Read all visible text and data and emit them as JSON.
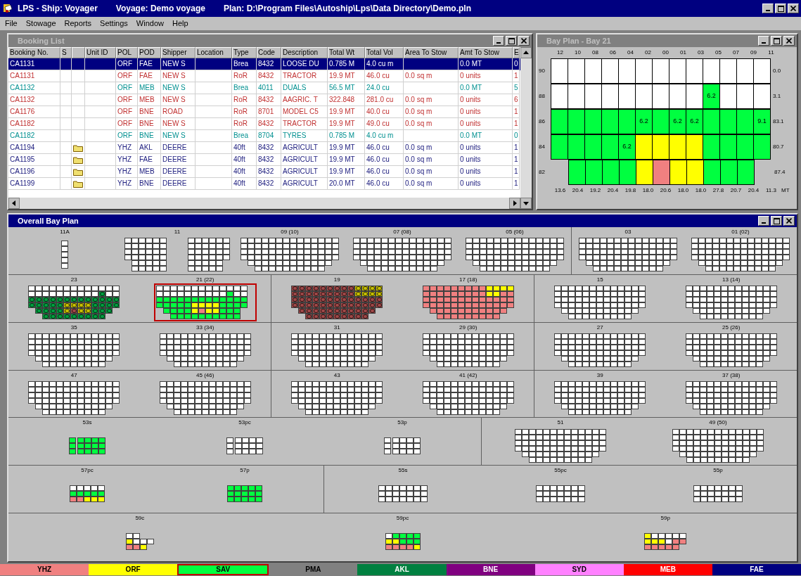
{
  "app": {
    "title_parts": [
      "LPS - Ship: Voyager",
      "Voyage: Demo voyage",
      "Plan: D:\\Program Files\\Autoship\\Lps\\Data Directory\\Demo.pln"
    ]
  },
  "menu": [
    "File",
    "Stowage",
    "Reports",
    "Settings",
    "Window",
    "Help"
  ],
  "booking_list": {
    "title": "Booking List",
    "active": false,
    "columns": [
      "Booking No.",
      "S",
      "",
      "Unit ID",
      "POL",
      "POD",
      "Shipper",
      "Location",
      "Type",
      "Code",
      "Description",
      "Total Wt",
      "Total Vol",
      "Area To Stow",
      "Amt To Stow",
      "E"
    ],
    "rows": [
      {
        "selected": true,
        "attachment": false,
        "booking_no": "CA1131",
        "pol": "ORF",
        "pod": "FAE",
        "shipper": "NEW S",
        "type": "Brea",
        "code": "8432",
        "description": "LOOSE DU",
        "total_wt": "0.785 M",
        "total_vol": "4.0 cu m",
        "amt_to_stow": "0.0 MT",
        "e": "0"
      },
      {
        "kind": "roro",
        "selected": false,
        "attachment": false,
        "booking_no": "CA1131",
        "pol": "ORF",
        "pod": "FAE",
        "shipper": "NEW S",
        "type": "RoR",
        "code": "8432",
        "description": "TRACTOR",
        "total_wt": "19.9 MT",
        "total_vol": "46.0 cu",
        "area_to_stow": "0.0 sq m",
        "amt_to_stow": "0 units",
        "e": "1"
      },
      {
        "kind": "break",
        "selected": false,
        "attachment": false,
        "booking_no": "CA1132",
        "pol": "ORF",
        "pod": "MEB",
        "shipper": "NEW S",
        "type": "Brea",
        "code": "4011",
        "description": "DUALS",
        "total_wt": "56.5 MT",
        "total_vol": "24.0 cu",
        "amt_to_stow": "0.0 MT",
        "e": "5"
      },
      {
        "kind": "roro",
        "selected": false,
        "attachment": false,
        "booking_no": "CA1132",
        "pol": "ORF",
        "pod": "MEB",
        "shipper": "NEW S",
        "type": "RoR",
        "code": "8432",
        "description": "AAGRIC. T",
        "total_wt": "322.848",
        "total_vol": "281.0 cu",
        "area_to_stow": "0.0 sq m",
        "amt_to_stow": "0 units",
        "e": "6"
      },
      {
        "kind": "roro",
        "selected": false,
        "attachment": false,
        "booking_no": "CA1176",
        "pol": "ORF",
        "pod": "BNE",
        "shipper": "ROAD",
        "type": "RoR",
        "code": "8701",
        "description": "MODEL C5",
        "total_wt": "19.9 MT",
        "total_vol": "40.0 cu",
        "area_to_stow": "0.0 sq m",
        "amt_to_stow": "0 units",
        "e": "1"
      },
      {
        "kind": "roro",
        "selected": false,
        "attachment": false,
        "booking_no": "CA1182",
        "pol": "ORF",
        "pod": "BNE",
        "shipper": "NEW S",
        "type": "RoR",
        "code": "8432",
        "description": "TRACTOR",
        "total_wt": "19.9 MT",
        "total_vol": "49.0 cu",
        "area_to_stow": "0.0 sq m",
        "amt_to_stow": "0 units",
        "e": "1"
      },
      {
        "kind": "break",
        "selected": false,
        "attachment": false,
        "booking_no": "CA1182",
        "pol": "ORF",
        "pod": "BNE",
        "shipper": "NEW S",
        "type": "Brea",
        "code": "8704",
        "description": "TYRES",
        "total_wt": "0.785 M",
        "total_vol": "4.0 cu m",
        "amt_to_stow": "0.0 MT",
        "e": "0"
      },
      {
        "kind": "container",
        "selected": false,
        "attachment": true,
        "booking_no": "CA1194",
        "pol": "YHZ",
        "pod": "AKL",
        "shipper": "DEERE",
        "type": "40ft",
        "code": "8432",
        "description": "AGRICULT",
        "total_wt": "19.9 MT",
        "total_vol": "46.0 cu",
        "area_to_stow": "0.0 sq m",
        "amt_to_stow": "0 units",
        "e": "1"
      },
      {
        "kind": "container",
        "selected": false,
        "attachment": true,
        "booking_no": "CA1195",
        "pol": "YHZ",
        "pod": "FAE",
        "shipper": "DEERE",
        "type": "40ft",
        "code": "8432",
        "description": "AGRICULT",
        "total_wt": "19.9 MT",
        "total_vol": "46.0 cu",
        "area_to_stow": "0.0 sq m",
        "amt_to_stow": "0 units",
        "e": "1"
      },
      {
        "kind": "container",
        "selected": false,
        "attachment": true,
        "booking_no": "CA1196",
        "pol": "YHZ",
        "pod": "MEB",
        "shipper": "DEERE",
        "type": "40ft",
        "code": "8432",
        "description": "AGRICULT",
        "total_wt": "19.9 MT",
        "total_vol": "46.0 cu",
        "area_to_stow": "0.0 sq m",
        "amt_to_stow": "0 units",
        "e": "1"
      },
      {
        "kind": "container",
        "selected": false,
        "attachment": true,
        "booking_no": "CA1199",
        "pol": "YHZ",
        "pod": "BNE",
        "shipper": "DEERE",
        "type": "40ft",
        "code": "8432",
        "description": "AGRICULT",
        "total_wt": "20.0 MT",
        "total_vol": "46.0 cu",
        "area_to_stow": "0.0 sq m",
        "amt_to_stow": "0 units",
        "e": "1"
      }
    ]
  },
  "bay_plan": {
    "title": "Bay Plan - Bay 21",
    "active": false,
    "column_labels": [
      "12",
      "10",
      "08",
      "06",
      "04",
      "02",
      "00",
      "01",
      "03",
      "05",
      "07",
      "09",
      "11"
    ],
    "rows": [
      {
        "label": "90",
        "weight": "0.0",
        "cells": [
          {
            "kind": "white"
          },
          {
            "kind": "white"
          },
          {
            "kind": "white"
          },
          {
            "kind": "white"
          },
          {
            "kind": "white"
          },
          {
            "kind": "white"
          },
          {
            "kind": "white"
          },
          {
            "kind": "white"
          },
          {
            "kind": "white"
          },
          {
            "kind": "white"
          },
          {
            "kind": "white"
          },
          {
            "kind": "white"
          },
          {
            "kind": "white"
          }
        ]
      },
      {
        "label": "88",
        "weight": "3.1",
        "cells": [
          {
            "kind": "white"
          },
          {
            "kind": "white"
          },
          {
            "kind": "white"
          },
          {
            "kind": "white"
          },
          {
            "kind": "white"
          },
          {
            "kind": "white"
          },
          {
            "kind": "white"
          },
          {
            "kind": "white"
          },
          {
            "kind": "white"
          },
          {
            "kind": "sav",
            "text": "6.2"
          },
          {
            "kind": "white"
          },
          {
            "kind": "white"
          },
          {
            "kind": "white"
          }
        ]
      },
      {
        "label": "86",
        "weight": "83.1",
        "cells": [
          {
            "kind": "sav"
          },
          {
            "kind": "sav"
          },
          {
            "kind": "sav"
          },
          {
            "kind": "sav"
          },
          {
            "kind": "sav"
          },
          {
            "kind": "sav",
            "text": "6.2"
          },
          {
            "kind": "sav"
          },
          {
            "kind": "sav",
            "text": "6.2"
          },
          {
            "kind": "sav",
            "text": "6.2"
          },
          {
            "kind": "sav"
          },
          {
            "kind": "sav"
          },
          {
            "kind": "sav"
          },
          {
            "kind": "sav",
            "text": "9.1"
          }
        ]
      },
      {
        "label": "84",
        "weight": "80.7",
        "cells": [
          {
            "kind": "sav"
          },
          {
            "kind": "sav"
          },
          {
            "kind": "sav"
          },
          {
            "kind": "sav"
          },
          {
            "kind": "sav",
            "text": "6.2"
          },
          {
            "kind": "orf"
          },
          {
            "kind": "orf"
          },
          {
            "kind": "orf"
          },
          {
            "kind": "orf"
          },
          {
            "kind": "sav"
          },
          {
            "kind": "sav"
          },
          {
            "kind": "sav"
          },
          {
            "kind": "sav"
          }
        ]
      },
      {
        "label": "82",
        "weight": "87.4",
        "cells": [
          {
            "kind": "none"
          },
          {
            "kind": "sav"
          },
          {
            "kind": "sav"
          },
          {
            "kind": "sav"
          },
          {
            "kind": "sav"
          },
          {
            "kind": "orf"
          },
          {
            "kind": "yhz"
          },
          {
            "kind": "orf"
          },
          {
            "kind": "orf"
          },
          {
            "kind": "sav"
          },
          {
            "kind": "sav"
          },
          {
            "kind": "sav"
          },
          {
            "kind": "none"
          }
        ]
      }
    ],
    "weights": [
      "13.6",
      "20.4",
      "19.2",
      "20.4",
      "19.8",
      "18.0",
      "20.6",
      "18.0",
      "18.0",
      "27.8",
      "20.7",
      "20.4",
      "11.3"
    ],
    "weight_unit": "MT"
  },
  "overall_bay_plan": {
    "title": "Overall Bay Plan",
    "active": true,
    "rows": [
      {
        "sections": [
          {
            "bays": [
              {
                "label": "11A",
                "selected": false,
                "blocks": [
                  [
                    {
                      "kind": "w"
                    },
                    {
                      "kind": "w"
                    },
                    {
                      "kind": "w"
                    },
                    {
                      "kind": "w"
                    },
                    {
                      "kind": "w"
                    }
                  ]
                ]
              },
              {
                "label": "11",
                "selected": false,
                "blocks": [
                  [
                    {
                      "kind": "wwwwww"
                    },
                    {
                      "kind": "wwwwww"
                    },
                    {
                      "kind": "wwwwww"
                    },
                    {
                      "kind": "wwwwww"
                    },
                    {
                      "kind": "nwwwww"
                    },
                    {
                      "kind": "nwwwww"
                    }
                  ],
                  [
                    {
                      "kind": "wwwwww"
                    },
                    {
                      "kind": "wwwwww"
                    },
                    {
                      "kind": "wwwwww"
                    },
                    {
                      "kind": "wwwwww"
                    },
                    {
                      "kind": "wwwwwn"
                    },
                    {
                      "kind": "wwwwwn"
                    }
                  ]
                ]
              },
              {
                "label": "09 (10)",
                "selected": false,
                "blocks": [
                  [
                    {
                      "kind": "wwwwwwwwwwwwww"
                    },
                    {
                      "kind": "wwwwwwwwwwwwww"
                    },
                    {
                      "kind": "wwwwwwwwwwwwww"
                    },
                    {
                      "kind": "wwwwwwwwwwwwww"
                    },
                    {
                      "kind": "nwwwwwwwwwwwwn"
                    },
                    {
                      "kind": "nnwwwwwwwwwwnn"
                    }
                  ]
                ]
              },
              {
                "label": "07 (08)",
                "selected": false,
                "blocks": [
                  [
                    {
                      "kind": "wwwwwwwwwwwwww"
                    },
                    {
                      "kind": "wwwwwwwwwwwwww"
                    },
                    {
                      "kind": "wwwwwwwwwwwwww"
                    },
                    {
                      "kind": "wwwwwwwwwwwwww"
                    },
                    {
                      "kind": "nwwwwwwwwwwwwn"
                    },
                    {
                      "kind": "nnwwwwwwwwwwnn"
                    }
                  ]
                ]
              },
              {
                "label": "05 (06)",
                "selected": false,
                "blocks": [
                  [
                    {
                      "kind": "wwwwwwwwwwwwww"
                    },
                    {
                      "kind": "wwwwwwwwwwwwww"
                    },
                    {
                      "kind": "wwwwwwwwwwwwww"
                    },
                    {
                      "kind": "wwwwwwwwwwwwww"
                    },
                    {
                      "kind": "nwwwwwwwwwwwwn"
                    },
                    {
                      "kind": "nnwwwwwwwwwwnn"
                    }
                  ]
                ]
              }
            ]
          },
          {
            "bays": [
              {
                "label": "03",
                "selected": false,
                "blocks": [
                  [
                    {
                      "kind": "wwwwwwwwwwwwww"
                    },
                    {
                      "kind": "wwwwwwwwwwwwww"
                    },
                    {
                      "kind": "wwwwwwwwwwwwww"
                    },
                    {
                      "kind": "wwwwwwwwwwwwww"
                    },
                    {
                      "kind": "nwwwwwwwwwwwwn"
                    },
                    {
                      "kind": "nnwwwwwwwwwwnn"
                    }
                  ]
                ]
              },
              {
                "label": "01 (02)",
                "selected": false,
                "blocks": [
                  [
                    {
                      "kind": "wwwwwwwwwwwwww"
                    },
                    {
                      "kind": "wwwwwwwwwwwwww"
                    },
                    {
                      "kind": "wwwwwwwwwwwwww"
                    },
                    {
                      "kind": "wwwwwwwwwwwwww"
                    },
                    {
                      "kind": "nwwwwwwwwwwwwn"
                    },
                    {
                      "kind": "nnwwwwwwwwwwnn"
                    }
                  ]
                ]
              }
            ]
          }
        ]
      },
      {
        "sections": [
          {
            "bays": [
              {
                "label": "23",
                "selected": false,
                "blocks": [
                  [
                    {
                      "kind": "wwwwwwwwwwwww"
                    },
                    {
                      "kind": "wwwwwwwwwwGww"
                    },
                    {
                      "kind": "GGGGGGGGGGGGG"
                    },
                    {
                      "kind": "GGGGGYYYYGGGG"
                    },
                    {
                      "kind": "nGGGGYRYYGGGn"
                    },
                    {
                      "kind": "nnGGGGGGGGGnn"
                    }
                  ]
                ]
              },
              {
                "label": "21 (22)",
                "selected": true,
                "blocks": [
                  [
                    {
                      "kind": "wwwwwwwwwwwww"
                    },
                    {
                      "kind": "wwwwwwwwwwgww"
                    },
                    {
                      "kind": "ggggggggggggg"
                    },
                    {
                      "kind": "gggggyyyygggg"
                    },
                    {
                      "kind": "nggggyryygggn"
                    },
                    {
                      "kind": "nnggggggggggnn"
                    }
                  ]
                ]
              }
            ]
          },
          {
            "bays": [
              {
                "label": "19",
                "selected": false,
                "blocks": [
                  [
                    {
                      "kind": "RRRRRRRRRYYYY"
                    },
                    {
                      "kind": "RRRRRRRRRYYYY"
                    },
                    {
                      "kind": "RRRRRRRRRRRRR"
                    },
                    {
                      "kind": "RRRRRRRRRRRRR"
                    },
                    {
                      "kind": "nRRRRRRRRRRRn"
                    },
                    {
                      "kind": "nnRRRRRRRRRnn"
                    }
                  ]
                ]
              },
              {
                "label": "17 (18)",
                "selected": false,
                "blocks": [
                  [
                    {
                      "kind": "rrrrrrrrryyyy"
                    },
                    {
                      "kind": "rrrrrrrrryyrr"
                    },
                    {
                      "kind": "rrrrrrrrrrrrr"
                    },
                    {
                      "kind": "rrrrrrrrrrrrr"
                    },
                    {
                      "kind": "nrrrrrrrrrrrn"
                    },
                    {
                      "kind": "nnrrrrrrrrrnn"
                    }
                  ]
                ]
              }
            ]
          },
          {
            "bays": [
              {
                "label": "15",
                "selected": false,
                "blocks": [
                  [
                    {
                      "kind": "wwwwwwwwwwwww"
                    },
                    {
                      "kind": "wwwwwwwwwwwww"
                    },
                    {
                      "kind": "wwwwwwwwwwwww"
                    },
                    {
                      "kind": "wwwwwwwwwwwww"
                    },
                    {
                      "kind": "nwwwwwwwwwwwn"
                    },
                    {
                      "kind": "nnwwwwwwwwwnn"
                    }
                  ]
                ]
              },
              {
                "label": "13 (14)",
                "selected": false,
                "blocks": [
                  [
                    {
                      "kind": "wwwwwwwwwwwww"
                    },
                    {
                      "kind": "wwwwwwwwwwwww"
                    },
                    {
                      "kind": "wwwwwwwwwwwww"
                    },
                    {
                      "kind": "wwwwwwwwwwwww"
                    },
                    {
                      "kind": "nwwwwwwwwwwwn"
                    },
                    {
                      "kind": "nnwwwwwwwwwnn"
                    }
                  ]
                ]
              }
            ]
          }
        ]
      },
      {
        "sections": [
          {
            "bays": [
              {
                "label": "35",
                "selected": false,
                "blocks": [
                  [
                    {
                      "kind": "wwwwwwwwwwwww"
                    },
                    {
                      "kind": "wwwwwwwwwwwww"
                    },
                    {
                      "kind": "wwwwwwwwwwwww"
                    },
                    {
                      "kind": "wwwwwwwwwwwww"
                    },
                    {
                      "kind": "nwwwwwwwwwwwn"
                    },
                    {
                      "kind": "nnwwwwwwwwwnn"
                    }
                  ]
                ]
              },
              {
                "label": "33 (34)",
                "selected": false,
                "blocks": [
                  [
                    {
                      "kind": "wwwwwwwwwwwww"
                    },
                    {
                      "kind": "wwwwwwwwwwwww"
                    },
                    {
                      "kind": "wwwwwwwwwwwww"
                    },
                    {
                      "kind": "wwwwwwwwwwwww"
                    },
                    {
                      "kind": "nwwwwwwwwwwwn"
                    },
                    {
                      "kind": "nnwwwwwwwwwnn"
                    }
                  ]
                ]
              }
            ]
          },
          {
            "bays": [
              {
                "label": "31",
                "selected": false,
                "blocks": [
                  [
                    {
                      "kind": "wwwwwwwwwwwww"
                    },
                    {
                      "kind": "wwwwwwwwwwwww"
                    },
                    {
                      "kind": "wwwwwwwwwwwww"
                    },
                    {
                      "kind": "wwwwwwwwwwwww"
                    },
                    {
                      "kind": "nwwwwwwwwwwwn"
                    },
                    {
                      "kind": "nnwwwwwwwwwnn"
                    }
                  ]
                ]
              },
              {
                "label": "29 (30)",
                "selected": false,
                "blocks": [
                  [
                    {
                      "kind": "wwwwwwwwwwwww"
                    },
                    {
                      "kind": "wwwwwwwwwwwww"
                    },
                    {
                      "kind": "wwwwwwwwwwwww"
                    },
                    {
                      "kind": "wwwwwwwwwwwww"
                    },
                    {
                      "kind": "nwwwwwwwwwwwn"
                    },
                    {
                      "kind": "nnwwwwwwwwwnn"
                    }
                  ]
                ]
              }
            ]
          },
          {
            "bays": [
              {
                "label": "27",
                "selected": false,
                "blocks": [
                  [
                    {
                      "kind": "wwwwwwwwwwwww"
                    },
                    {
                      "kind": "wwwwwwwwwwwww"
                    },
                    {
                      "kind": "wwwwwwwwwwwww"
                    },
                    {
                      "kind": "wwwwwwwwwwwww"
                    },
                    {
                      "kind": "nwwwwwwwwwwwn"
                    },
                    {
                      "kind": "nnwwwwwwwwwnn"
                    }
                  ]
                ]
              },
              {
                "label": "25 (26)",
                "selected": false,
                "blocks": [
                  [
                    {
                      "kind": "wwwwwwwwwwwww"
                    },
                    {
                      "kind": "wwwwwwwwwwwww"
                    },
                    {
                      "kind": "wwwwwwwwwwwww"
                    },
                    {
                      "kind": "wwwwwwwwwwwww"
                    },
                    {
                      "kind": "nwwwwwwwwwwwn"
                    },
                    {
                      "kind": "nnwwwwwwwwwnn"
                    }
                  ]
                ]
              }
            ]
          }
        ]
      },
      {
        "sections": [
          {
            "bays": [
              {
                "label": "47",
                "selected": false,
                "blocks": [
                  [
                    {
                      "kind": "wwwwwwwwwwwww"
                    },
                    {
                      "kind": "wwwwwwwwwwwww"
                    },
                    {
                      "kind": "wwwwwwwwwwwww"
                    },
                    {
                      "kind": "wwwwwwwwwwwww"
                    },
                    {
                      "kind": "nwwwwwwwwwwwn"
                    },
                    {
                      "kind": "nnwwwwwwwwwnn"
                    }
                  ]
                ]
              },
              {
                "label": "45 (46)",
                "selected": false,
                "blocks": [
                  [
                    {
                      "kind": "wwwwwwwwwwwww"
                    },
                    {
                      "kind": "wwwwwwwwwwwww"
                    },
                    {
                      "kind": "wwwwwwwwwwwww"
                    },
                    {
                      "kind": "wwwwwwwwwwwww"
                    },
                    {
                      "kind": "nwwwwwwwwwwwn"
                    },
                    {
                      "kind": "nnwwwwwwwwwnn"
                    }
                  ]
                ]
              }
            ]
          },
          {
            "bays": [
              {
                "label": "43",
                "selected": false,
                "blocks": [
                  [
                    {
                      "kind": "wwwwwwwwwwwww"
                    },
                    {
                      "kind": "wwwwwwwwwwwww"
                    },
                    {
                      "kind": "wwwwwwwwwwwww"
                    },
                    {
                      "kind": "wwwwwwwwwwwww"
                    },
                    {
                      "kind": "nwwwwwwwwwwwn"
                    },
                    {
                      "kind": "nnwwwwwwwwwnn"
                    }
                  ]
                ]
              },
              {
                "label": "41 (42)",
                "selected": false,
                "blocks": [
                  [
                    {
                      "kind": "wwwwwwwwwwwww"
                    },
                    {
                      "kind": "wwwwwwwwwwwww"
                    },
                    {
                      "kind": "wwwwwwwwwwwww"
                    },
                    {
                      "kind": "wwwwwwwwwwwww"
                    },
                    {
                      "kind": "nwwwwwwwwwwwn"
                    },
                    {
                      "kind": "nnwwwwwwwwwnn"
                    }
                  ]
                ]
              }
            ]
          },
          {
            "bays": [
              {
                "label": "39",
                "selected": false,
                "blocks": [
                  [
                    {
                      "kind": "wwwwwwwwwwwww"
                    },
                    {
                      "kind": "wwwwwwwwwwwww"
                    },
                    {
                      "kind": "wwwwwwwwwwwww"
                    },
                    {
                      "kind": "wwwwwwwwwwwww"
                    },
                    {
                      "kind": "nwwwwwwwwwwwn"
                    },
                    {
                      "kind": "nnwwwwwwwwwnn"
                    }
                  ]
                ]
              },
              {
                "label": "37 (38)",
                "selected": false,
                "blocks": [
                  [
                    {
                      "kind": "wwwwwwwwwwwww"
                    },
                    {
                      "kind": "wwwwwwwwwwwww"
                    },
                    {
                      "kind": "wwwwwwwwwwwww"
                    },
                    {
                      "kind": "wwwwwwwwwwwww"
                    },
                    {
                      "kind": "nwwwwwwwwwwwn"
                    },
                    {
                      "kind": "nnwwwwwwwwwnn"
                    }
                  ]
                ]
              }
            ]
          }
        ]
      },
      {
        "sections": [
          {
            "bays": [
              {
                "label": "53s",
                "selected": false,
                "blocks": [
                  [
                    {
                      "kind": "g"
                    },
                    {
                      "kind": "g"
                    },
                    {
                      "kind": "g"
                    }
                  ],
                  [
                    {
                      "kind": "gggg"
                    },
                    {
                      "kind": "gggg"
                    },
                    {
                      "kind": "gggg"
                    }
                  ]
                ]
              },
              {
                "label": "53pc",
                "selected": false,
                "blocks": [
                  [
                    {
                      "kind": "w"
                    },
                    {
                      "kind": "w"
                    },
                    {
                      "kind": "w"
                    }
                  ],
                  [
                    {
                      "kind": "wwww"
                    },
                    {
                      "kind": "wwww"
                    },
                    {
                      "kind": "wwww"
                    }
                  ]
                ]
              },
              {
                "label": "53p",
                "selected": false,
                "blocks": [
                  [
                    {
                      "kind": "w"
                    },
                    {
                      "kind": "w"
                    },
                    {
                      "kind": "w"
                    }
                  ],
                  [
                    {
                      "kind": "wwww"
                    },
                    {
                      "kind": "wwww"
                    },
                    {
                      "kind": "wwww"
                    }
                  ]
                ]
              }
            ]
          },
          {
            "bays": [
              {
                "label": "51",
                "selected": false,
                "blocks": [
                  [
                    {
                      "kind": "wwwwwwwwwwwww"
                    },
                    {
                      "kind": "wwwwwwwwwwwww"
                    },
                    {
                      "kind": "wwwwwwwwwwwww"
                    },
                    {
                      "kind": "wwwwwwwwwwwww"
                    },
                    {
                      "kind": "nwwwwwwwwwwwn"
                    },
                    {
                      "kind": "nnwwwwwwwwwnn"
                    }
                  ]
                ]
              },
              {
                "label": "49 (50)",
                "selected": false,
                "blocks": [
                  [
                    {
                      "kind": "wwwwwwwwwwwww"
                    },
                    {
                      "kind": "wwwwwwwwwwwww"
                    },
                    {
                      "kind": "wwwwwwwwwwwww"
                    },
                    {
                      "kind": "wwwwwwwwwwwww"
                    },
                    {
                      "kind": "nwwwwwwwwwwwn"
                    },
                    {
                      "kind": "nnwwwwwwwwwnn"
                    }
                  ]
                ]
              }
            ]
          }
        ]
      },
      {
        "sections": [
          {
            "bays": [
              {
                "label": "57pc",
                "selected": false,
                "blocks": [
                  [
                    {
                      "kind": "wwwww"
                    },
                    {
                      "kind": "ggggg"
                    },
                    {
                      "kind": "rryyy"
                    }
                  ]
                ]
              },
              {
                "label": "57p",
                "selected": false,
                "blocks": [
                  [
                    {
                      "kind": "ggggg"
                    },
                    {
                      "kind": "ggggg"
                    },
                    {
                      "kind": "ggggg"
                    }
                  ]
                ]
              }
            ]
          },
          {
            "bays": [
              {
                "label": "55s",
                "selected": false,
                "blocks": [
                  [
                    {
                      "kind": "wwwwwww"
                    },
                    {
                      "kind": "wwwwwww"
                    },
                    {
                      "kind": "wwwwwww"
                    }
                  ]
                ]
              },
              {
                "label": "55pc",
                "selected": false,
                "blocks": [
                  [
                    {
                      "kind": "wwwwwww"
                    },
                    {
                      "kind": "wwwwwww"
                    },
                    {
                      "kind": "wwwwwww"
                    }
                  ]
                ]
              },
              {
                "label": "55p",
                "selected": false,
                "blocks": [
                  [
                    {
                      "kind": "wwwwwww"
                    },
                    {
                      "kind": "wwwwwww"
                    },
                    {
                      "kind": "wwwwwww"
                    }
                  ]
                ]
              }
            ]
          }
        ]
      },
      {
        "sections": [
          {
            "bays": [
              {
                "label": "59c",
                "selected": false,
                "blocks": [
                  [
                    {
                      "kind": "wwnn"
                    },
                    {
                      "kind": "ywww"
                    },
                    {
                      "kind": "rryn"
                    }
                  ]
                ]
              },
              {
                "label": "59pc",
                "selected": false,
                "blocks": [
                  [
                    {
                      "kind": "wgggg"
                    },
                    {
                      "kind": "yyggg"
                    },
                    {
                      "kind": "rrrry"
                    }
                  ]
                ]
              },
              {
                "label": "59p",
                "selected": false,
                "blocks": [
                  [
                    {
                      "kind": "ywwwww"
                    },
                    {
                      "kind": "yyywrr"
                    },
                    {
                      "kind": "rrrrrn"
                    }
                  ]
                ]
              }
            ]
          }
        ]
      }
    ]
  },
  "ports": [
    {
      "name": "YHZ",
      "color": "#f08080",
      "selected": false
    },
    {
      "name": "ORF",
      "color": "#ffff00",
      "selected": false
    },
    {
      "name": "SAV",
      "color": "#00ff40",
      "selected": true
    },
    {
      "name": "PMA",
      "color": "#808080",
      "selected": false
    },
    {
      "name": "AKL",
      "color": "#008040",
      "selected": false
    },
    {
      "name": "BNE",
      "color": "#800080",
      "selected": false
    },
    {
      "name": "SYD",
      "color": "#ff80ff",
      "selected": false
    },
    {
      "name": "MEB",
      "color": "#ff0000",
      "selected": false
    },
    {
      "name": "FAE",
      "color": "#000080",
      "selected": false
    }
  ]
}
